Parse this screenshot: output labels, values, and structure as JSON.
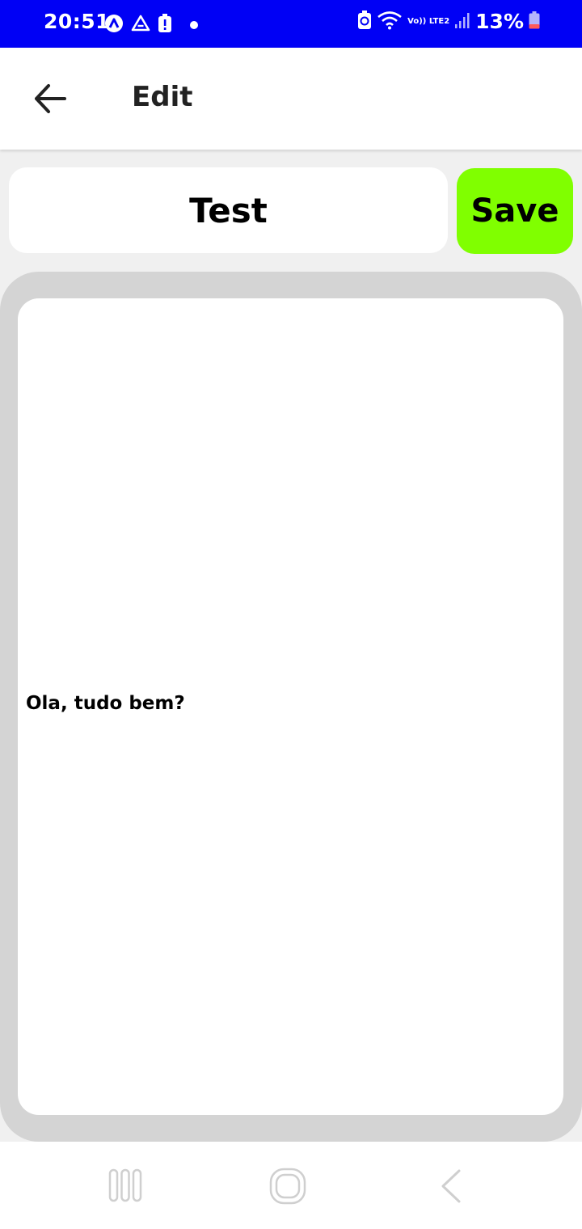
{
  "status_bar": {
    "time": "20:51",
    "battery_percent": "13%",
    "network_label": "Vo)) LTE2",
    "background_color": "#0000f5",
    "left_icons": [
      "a-circle-icon",
      "drive-icon",
      "alert-battery-icon",
      "dot-icon"
    ],
    "right_icons": [
      "battery-saver-icon",
      "wifi-icon",
      "volte-icon",
      "signal-icon",
      "battery-icon"
    ]
  },
  "app_bar": {
    "title": "Edit",
    "back_icon": "arrow-left-icon"
  },
  "note": {
    "title_value": "Test",
    "save_label": "Save",
    "save_color": "#80ff00",
    "body_text": "Ola, tudo bem?"
  },
  "nav_bar": {
    "buttons": [
      "recent-apps-icon",
      "home-icon",
      "back-chevron-icon"
    ]
  }
}
